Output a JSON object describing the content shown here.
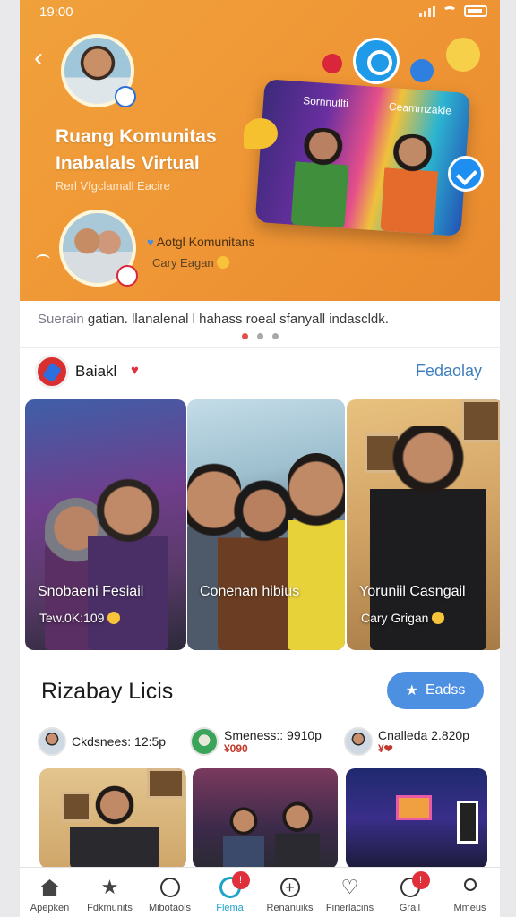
{
  "status": {
    "time": "19:00"
  },
  "hero": {
    "title": "Ruang Komunitas Inabalals Virtual",
    "subtitle": "Rerl Vfgclamall Eacire",
    "community_label": "Aotgl Komunitans",
    "community_author": "Cary Eagan",
    "poster_left": "Sornnuflti",
    "poster_right": "Ceammzakle"
  },
  "announcement": {
    "lead": "Suerain",
    "text": " gatian. llanalenal l hahass roeal sfanyall indascldk."
  },
  "pager": {
    "count": 3,
    "active": 0
  },
  "section1": {
    "title": "Baiakl",
    "link": "Fedaolay",
    "cards": [
      {
        "title": "Snobaeni Fesiail",
        "meta": "Tew.0K:109"
      },
      {
        "title": "Conenan hibius",
        "meta": ""
      },
      {
        "title": "Yoruniil Casngail",
        "meta": "Cary Grigan"
      }
    ]
  },
  "section2": {
    "title": "Rizabay Licis",
    "button": "Eadss",
    "items": [
      {
        "name": "Ckdsnees: 12:5p",
        "sub": ""
      },
      {
        "name": "Smeness:: 9910p",
        "sub": "¥090"
      },
      {
        "name": "Cnalleda 2.820p",
        "sub": "¥❤"
      }
    ]
  },
  "nav": [
    {
      "label": "Apepken",
      "icon": "home-icon",
      "badge": ""
    },
    {
      "label": "Fdkmunits",
      "icon": "star-icon",
      "badge": ""
    },
    {
      "label": "Mibotaols",
      "icon": "search-icon",
      "badge": ""
    },
    {
      "label": "Flema",
      "icon": "ring-icon",
      "badge": "!"
    },
    {
      "label": "Renanuiks",
      "icon": "plus-icon",
      "badge": ""
    },
    {
      "label": "Finerlacins",
      "icon": "heart-icon",
      "badge": ""
    },
    {
      "label": "Grail",
      "icon": "search-icon",
      "badge": "!"
    },
    {
      "label": "Mmeus",
      "icon": "user-icon",
      "badge": ""
    }
  ],
  "colors": {
    "hero": "#ef9535",
    "accent": "#4d8fe0",
    "active": "#1fa3c7",
    "badge": "#e0303c"
  }
}
